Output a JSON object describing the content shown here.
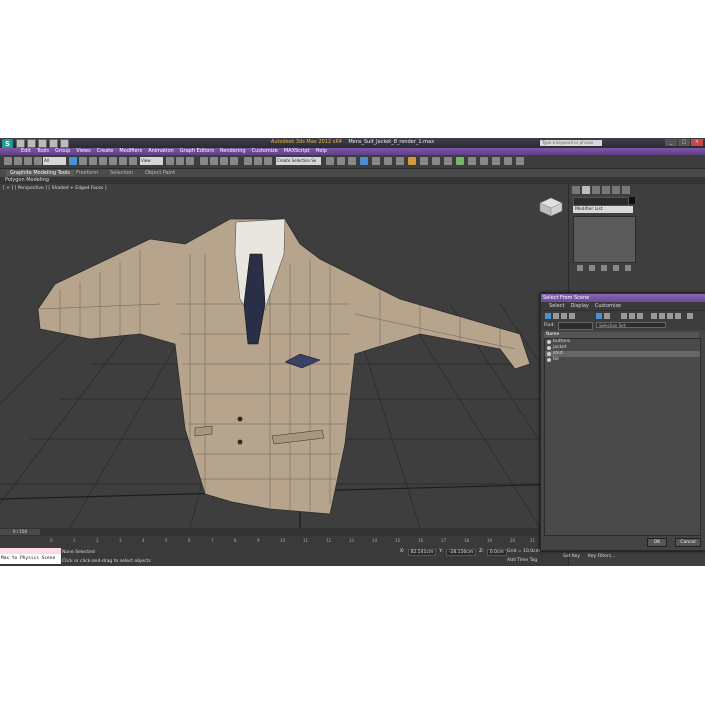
{
  "window": {
    "app_name": "Autodesk 3ds Max 2012 x64",
    "file_name": "Mens_Suit_Jacket_8_render_1.max",
    "search_placeholder": "Type a keyword or phrase"
  },
  "menu": [
    "Edit",
    "Tools",
    "Group",
    "Views",
    "Create",
    "Modifiers",
    "Animation",
    "Graph Editors",
    "Rendering",
    "Customize",
    "MAXScript",
    "Help"
  ],
  "toolbar": {
    "selection_filter": "All",
    "ref_coord": "View",
    "named_selection": "Create Selection Se"
  },
  "ribbon": {
    "tabs": [
      "Graphite Modeling Tools",
      "Freeform",
      "Selection",
      "Object Paint"
    ],
    "active_tab": "Graphite Modeling Tools",
    "sub_label": "Polygon Modeling"
  },
  "viewport": {
    "label": "[ + ] [ Perspective ] [ Shaded + Edged Faces ]"
  },
  "command_panel": {
    "modifier_list": "Modifier List"
  },
  "select_dialog": {
    "title": "Select From Scene",
    "menu": [
      "Select",
      "Display",
      "Customize"
    ],
    "find_label": "Find:",
    "selection_set": "Selection Set:",
    "column_header": "Name",
    "items": [
      "buttons",
      "jacket",
      "shirt",
      "tie"
    ],
    "selected_index": 2,
    "ok": "OK",
    "cancel": "Cancel"
  },
  "timeline": {
    "slider": "0 / 100",
    "ticks": [
      "0",
      "1",
      "2",
      "3",
      "4",
      "5",
      "6",
      "7",
      "8",
      "9",
      "10",
      "11",
      "12",
      "13",
      "14",
      "15",
      "16",
      "17",
      "18",
      "19",
      "20",
      "21"
    ]
  },
  "status": {
    "maxscript_top": "",
    "maxscript_bottom": "Max to Physics Scene",
    "line1": "None Selected",
    "line2": "Click or click-and-drag to select objects",
    "x_label": "X:",
    "x_value": "82.541cm",
    "y_label": "Y:",
    "y_value": "-28.156cm",
    "z_label": "Z:",
    "z_value": "0.0cm",
    "grid": "Grid = 10.0cm",
    "add_time_tag": "Add Time Tag",
    "set_key": "Set Key",
    "key_filters": "Key Filters..."
  }
}
